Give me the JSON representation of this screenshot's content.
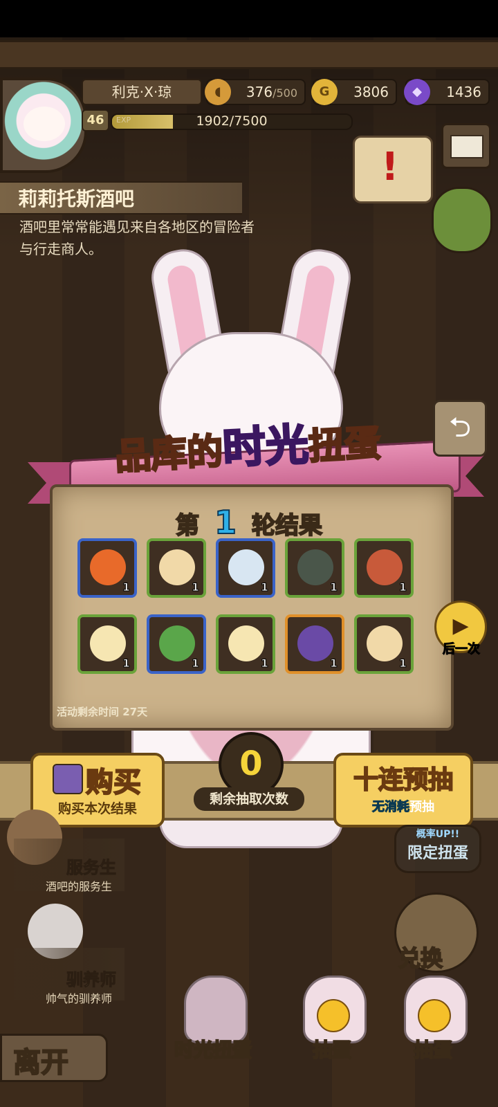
{
  "player": {
    "name": "利克·X·琼",
    "level": "46",
    "exp_tag": "EXP",
    "exp_text": "1902/7500",
    "exp_fraction": 0.254
  },
  "resources": {
    "stamina_value": "376",
    "stamina_max": "/500",
    "gold": "3806",
    "gems": "1436"
  },
  "location": {
    "title": "莉莉托斯酒吧",
    "description": "酒吧里常常能遇见来自各地区的冒险者与行走商人。"
  },
  "event": {
    "title_a": "品库的",
    "title_b": "时光",
    "title_c": "扭蛋",
    "round_prefix": "第",
    "round_number": "1",
    "round_suffix": "轮结果",
    "timer_text": "活动剩余时间 27天",
    "next_label": "后一次"
  },
  "results": [
    {
      "name": "fire-horn",
      "rarity": "blue",
      "qty": "1",
      "color": "#e86a2a"
    },
    {
      "name": "cream-egg",
      "rarity": "green",
      "qty": "1",
      "color": "#f1d9a8"
    },
    {
      "name": "cloud-ship",
      "rarity": "blue",
      "qty": "1",
      "color": "#d8e6f2"
    },
    {
      "name": "turtle-shell",
      "rarity": "green",
      "qty": "1",
      "color": "#4a564a"
    },
    {
      "name": "lava-egg",
      "rarity": "green",
      "qty": "1",
      "color": "#c85a3a"
    },
    {
      "name": "silver-egg",
      "rarity": "green",
      "qty": "1",
      "color": "#f6e6b2"
    },
    {
      "name": "cactus-egg",
      "rarity": "blue",
      "qty": "1",
      "color": "#5aa64a"
    },
    {
      "name": "silver-egg",
      "rarity": "green",
      "qty": "1",
      "color": "#f6e6b2"
    },
    {
      "name": "pocket-watch",
      "rarity": "orange",
      "qty": "1",
      "color": "#6a4aa6"
    },
    {
      "name": "cream-egg",
      "rarity": "green",
      "qty": "1",
      "color": "#f1d9a8"
    }
  ],
  "actions": {
    "buy_label": "购买",
    "buy_sub": "购买本次结果",
    "remaining_count": "0",
    "remaining_label": "剩余抽取次数",
    "pull_label": "十连预抽",
    "pull_sub_a": "无消耗",
    "pull_sub_b": "预抽"
  },
  "npcs": [
    {
      "name": "服务生",
      "desc": "酒吧的服务生"
    },
    {
      "name": "驯养师",
      "desc": "帅气的驯养师"
    }
  ],
  "side": {
    "limited_top": "概率UP!!",
    "limited_label": "限定扭蛋",
    "exchange_label": "兑换"
  },
  "bottom": {
    "leave_label": "离开",
    "time_gacha": "时光扭蛋",
    "gacha_gem": "抽蛋",
    "gacha_gold": "抽蛋"
  }
}
